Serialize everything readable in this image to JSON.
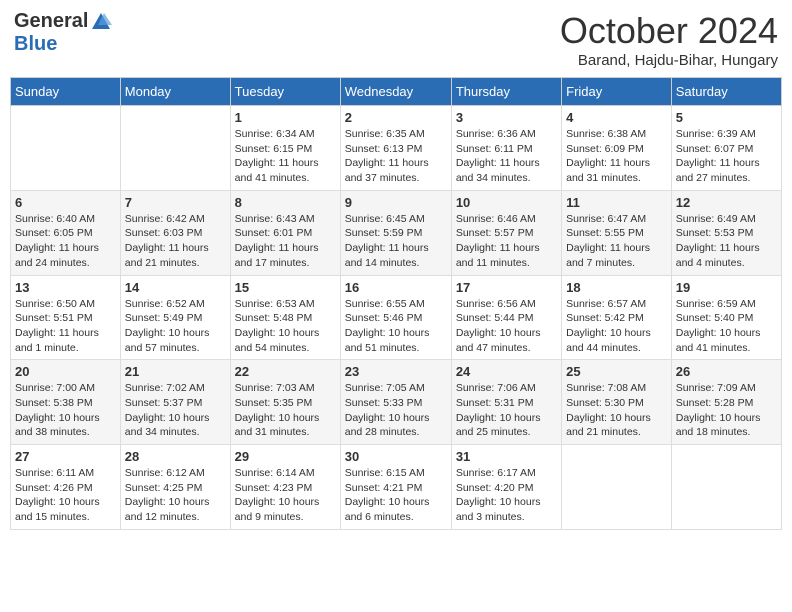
{
  "header": {
    "logo_general": "General",
    "logo_blue": "Blue",
    "month": "October 2024",
    "location": "Barand, Hajdu-Bihar, Hungary"
  },
  "days_of_week": [
    "Sunday",
    "Monday",
    "Tuesday",
    "Wednesday",
    "Thursday",
    "Friday",
    "Saturday"
  ],
  "weeks": [
    [
      {
        "day": "",
        "info": ""
      },
      {
        "day": "",
        "info": ""
      },
      {
        "day": "1",
        "info": "Sunrise: 6:34 AM\nSunset: 6:15 PM\nDaylight: 11 hours and 41 minutes."
      },
      {
        "day": "2",
        "info": "Sunrise: 6:35 AM\nSunset: 6:13 PM\nDaylight: 11 hours and 37 minutes."
      },
      {
        "day": "3",
        "info": "Sunrise: 6:36 AM\nSunset: 6:11 PM\nDaylight: 11 hours and 34 minutes."
      },
      {
        "day": "4",
        "info": "Sunrise: 6:38 AM\nSunset: 6:09 PM\nDaylight: 11 hours and 31 minutes."
      },
      {
        "day": "5",
        "info": "Sunrise: 6:39 AM\nSunset: 6:07 PM\nDaylight: 11 hours and 27 minutes."
      }
    ],
    [
      {
        "day": "6",
        "info": "Sunrise: 6:40 AM\nSunset: 6:05 PM\nDaylight: 11 hours and 24 minutes."
      },
      {
        "day": "7",
        "info": "Sunrise: 6:42 AM\nSunset: 6:03 PM\nDaylight: 11 hours and 21 minutes."
      },
      {
        "day": "8",
        "info": "Sunrise: 6:43 AM\nSunset: 6:01 PM\nDaylight: 11 hours and 17 minutes."
      },
      {
        "day": "9",
        "info": "Sunrise: 6:45 AM\nSunset: 5:59 PM\nDaylight: 11 hours and 14 minutes."
      },
      {
        "day": "10",
        "info": "Sunrise: 6:46 AM\nSunset: 5:57 PM\nDaylight: 11 hours and 11 minutes."
      },
      {
        "day": "11",
        "info": "Sunrise: 6:47 AM\nSunset: 5:55 PM\nDaylight: 11 hours and 7 minutes."
      },
      {
        "day": "12",
        "info": "Sunrise: 6:49 AM\nSunset: 5:53 PM\nDaylight: 11 hours and 4 minutes."
      }
    ],
    [
      {
        "day": "13",
        "info": "Sunrise: 6:50 AM\nSunset: 5:51 PM\nDaylight: 11 hours and 1 minute."
      },
      {
        "day": "14",
        "info": "Sunrise: 6:52 AM\nSunset: 5:49 PM\nDaylight: 10 hours and 57 minutes."
      },
      {
        "day": "15",
        "info": "Sunrise: 6:53 AM\nSunset: 5:48 PM\nDaylight: 10 hours and 54 minutes."
      },
      {
        "day": "16",
        "info": "Sunrise: 6:55 AM\nSunset: 5:46 PM\nDaylight: 10 hours and 51 minutes."
      },
      {
        "day": "17",
        "info": "Sunrise: 6:56 AM\nSunset: 5:44 PM\nDaylight: 10 hours and 47 minutes."
      },
      {
        "day": "18",
        "info": "Sunrise: 6:57 AM\nSunset: 5:42 PM\nDaylight: 10 hours and 44 minutes."
      },
      {
        "day": "19",
        "info": "Sunrise: 6:59 AM\nSunset: 5:40 PM\nDaylight: 10 hours and 41 minutes."
      }
    ],
    [
      {
        "day": "20",
        "info": "Sunrise: 7:00 AM\nSunset: 5:38 PM\nDaylight: 10 hours and 38 minutes."
      },
      {
        "day": "21",
        "info": "Sunrise: 7:02 AM\nSunset: 5:37 PM\nDaylight: 10 hours and 34 minutes."
      },
      {
        "day": "22",
        "info": "Sunrise: 7:03 AM\nSunset: 5:35 PM\nDaylight: 10 hours and 31 minutes."
      },
      {
        "day": "23",
        "info": "Sunrise: 7:05 AM\nSunset: 5:33 PM\nDaylight: 10 hours and 28 minutes."
      },
      {
        "day": "24",
        "info": "Sunrise: 7:06 AM\nSunset: 5:31 PM\nDaylight: 10 hours and 25 minutes."
      },
      {
        "day": "25",
        "info": "Sunrise: 7:08 AM\nSunset: 5:30 PM\nDaylight: 10 hours and 21 minutes."
      },
      {
        "day": "26",
        "info": "Sunrise: 7:09 AM\nSunset: 5:28 PM\nDaylight: 10 hours and 18 minutes."
      }
    ],
    [
      {
        "day": "27",
        "info": "Sunrise: 6:11 AM\nSunset: 4:26 PM\nDaylight: 10 hours and 15 minutes."
      },
      {
        "day": "28",
        "info": "Sunrise: 6:12 AM\nSunset: 4:25 PM\nDaylight: 10 hours and 12 minutes."
      },
      {
        "day": "29",
        "info": "Sunrise: 6:14 AM\nSunset: 4:23 PM\nDaylight: 10 hours and 9 minutes."
      },
      {
        "day": "30",
        "info": "Sunrise: 6:15 AM\nSunset: 4:21 PM\nDaylight: 10 hours and 6 minutes."
      },
      {
        "day": "31",
        "info": "Sunrise: 6:17 AM\nSunset: 4:20 PM\nDaylight: 10 hours and 3 minutes."
      },
      {
        "day": "",
        "info": ""
      },
      {
        "day": "",
        "info": ""
      }
    ]
  ]
}
